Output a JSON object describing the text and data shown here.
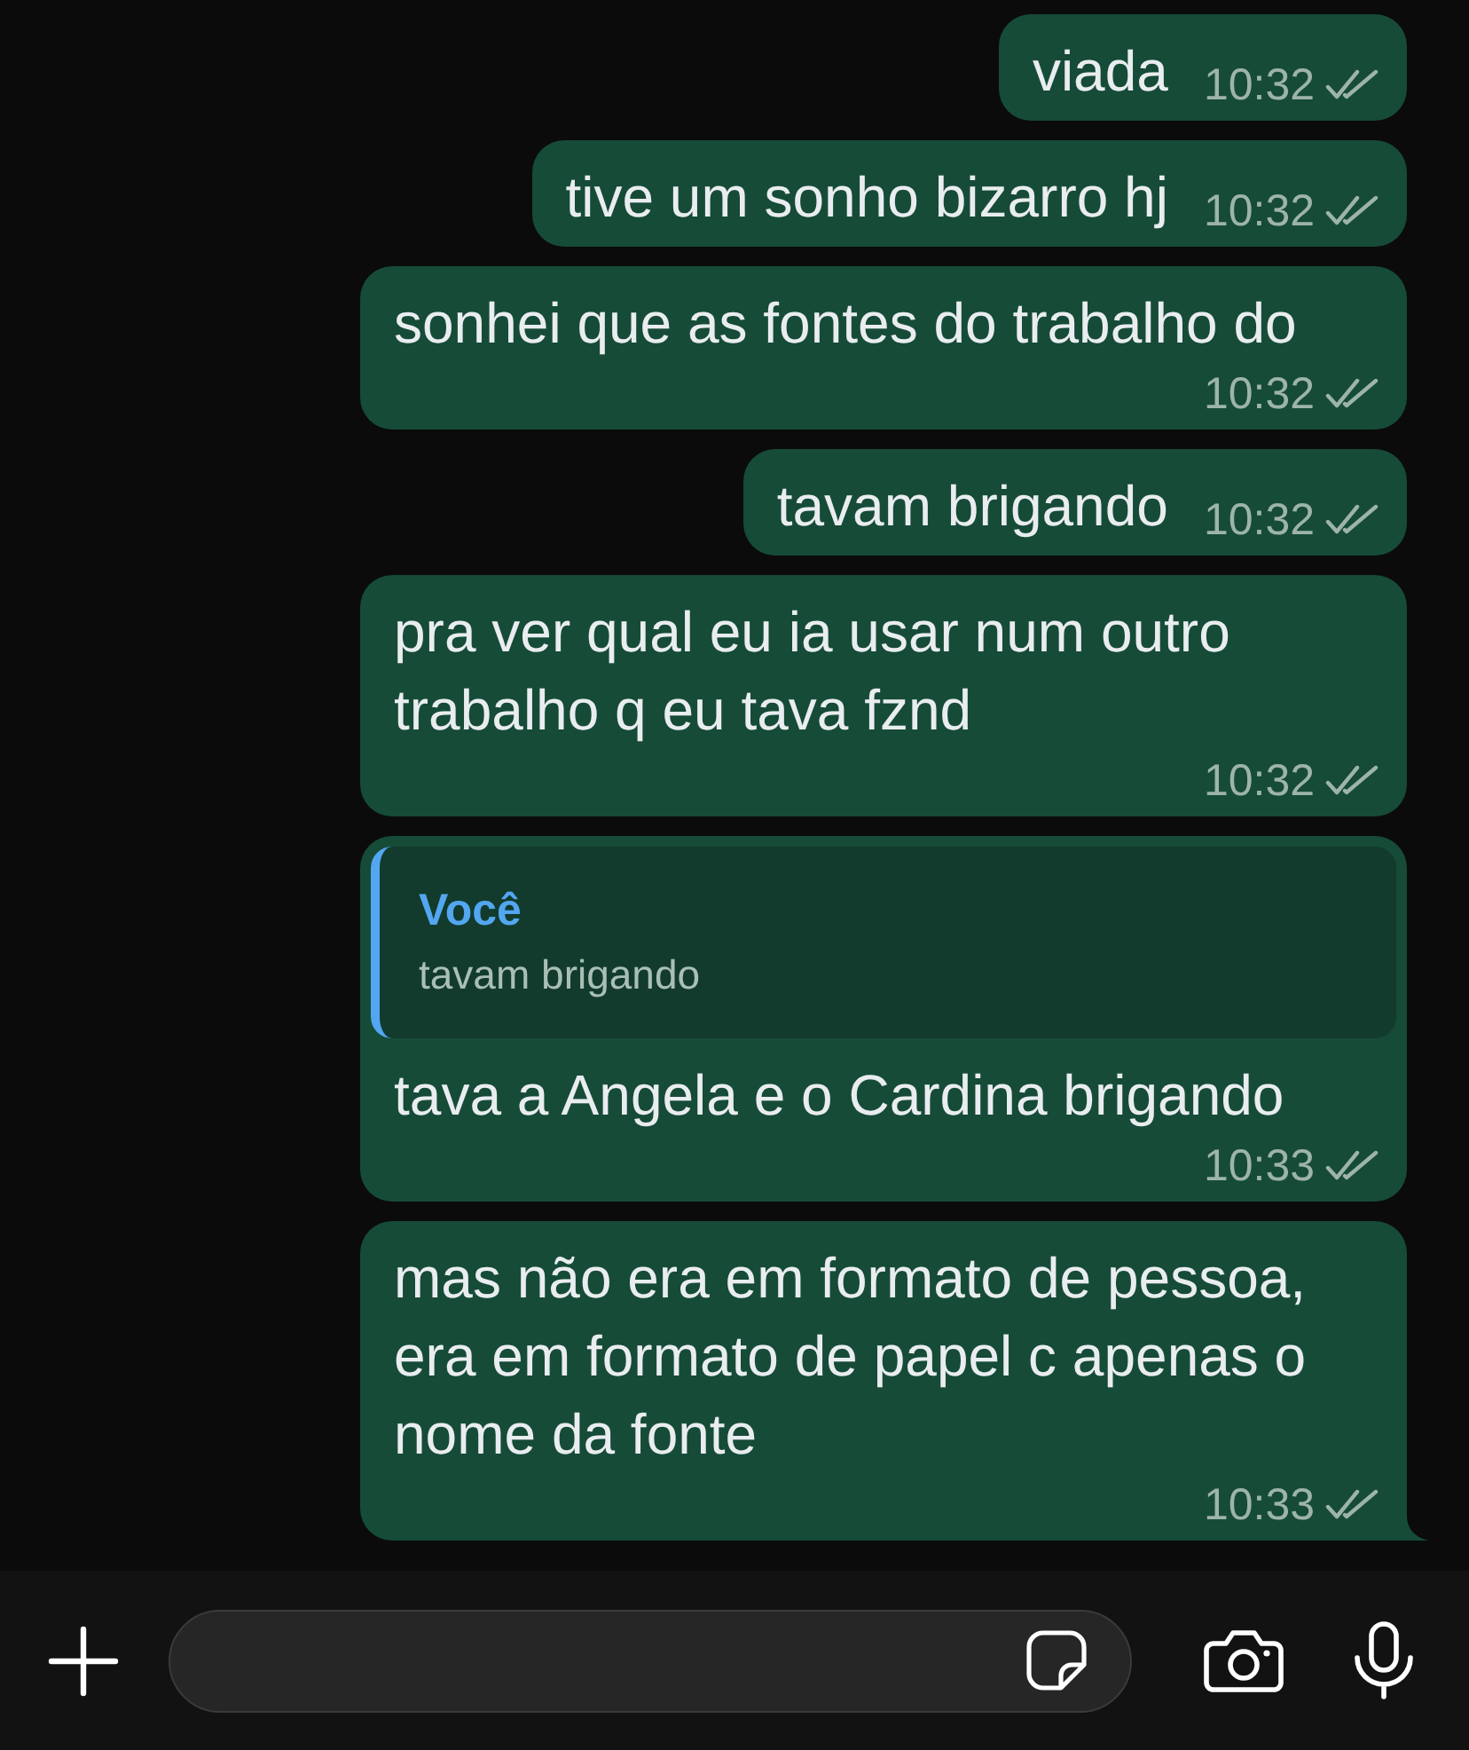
{
  "messages": [
    {
      "text": "viada",
      "time": "10:32",
      "read": false,
      "tail": false
    },
    {
      "text": "tive um sonho bizarro hj",
      "time": "10:32",
      "read": false,
      "tail": false
    },
    {
      "text": "sonhei que as fontes do trabalho do",
      "time": "10:32",
      "read": false,
      "tail": false
    },
    {
      "text": "tavam brigando",
      "time": "10:32",
      "read": false,
      "tail": false
    },
    {
      "text": "pra ver qual eu ia usar num outro trabalho q eu tava fznd",
      "time": "10:32",
      "read": false,
      "tail": false
    },
    {
      "reply": {
        "sender": "Você",
        "text": "tavam brigando"
      },
      "text": "tava a Angela e o Cardina brigando",
      "time": "10:33",
      "read": false,
      "tail": false
    },
    {
      "text": "mas não era em formato de pessoa, era em formato de papel c apenas o nome da fonte",
      "time": "10:33",
      "read": false,
      "tail": true
    }
  ]
}
